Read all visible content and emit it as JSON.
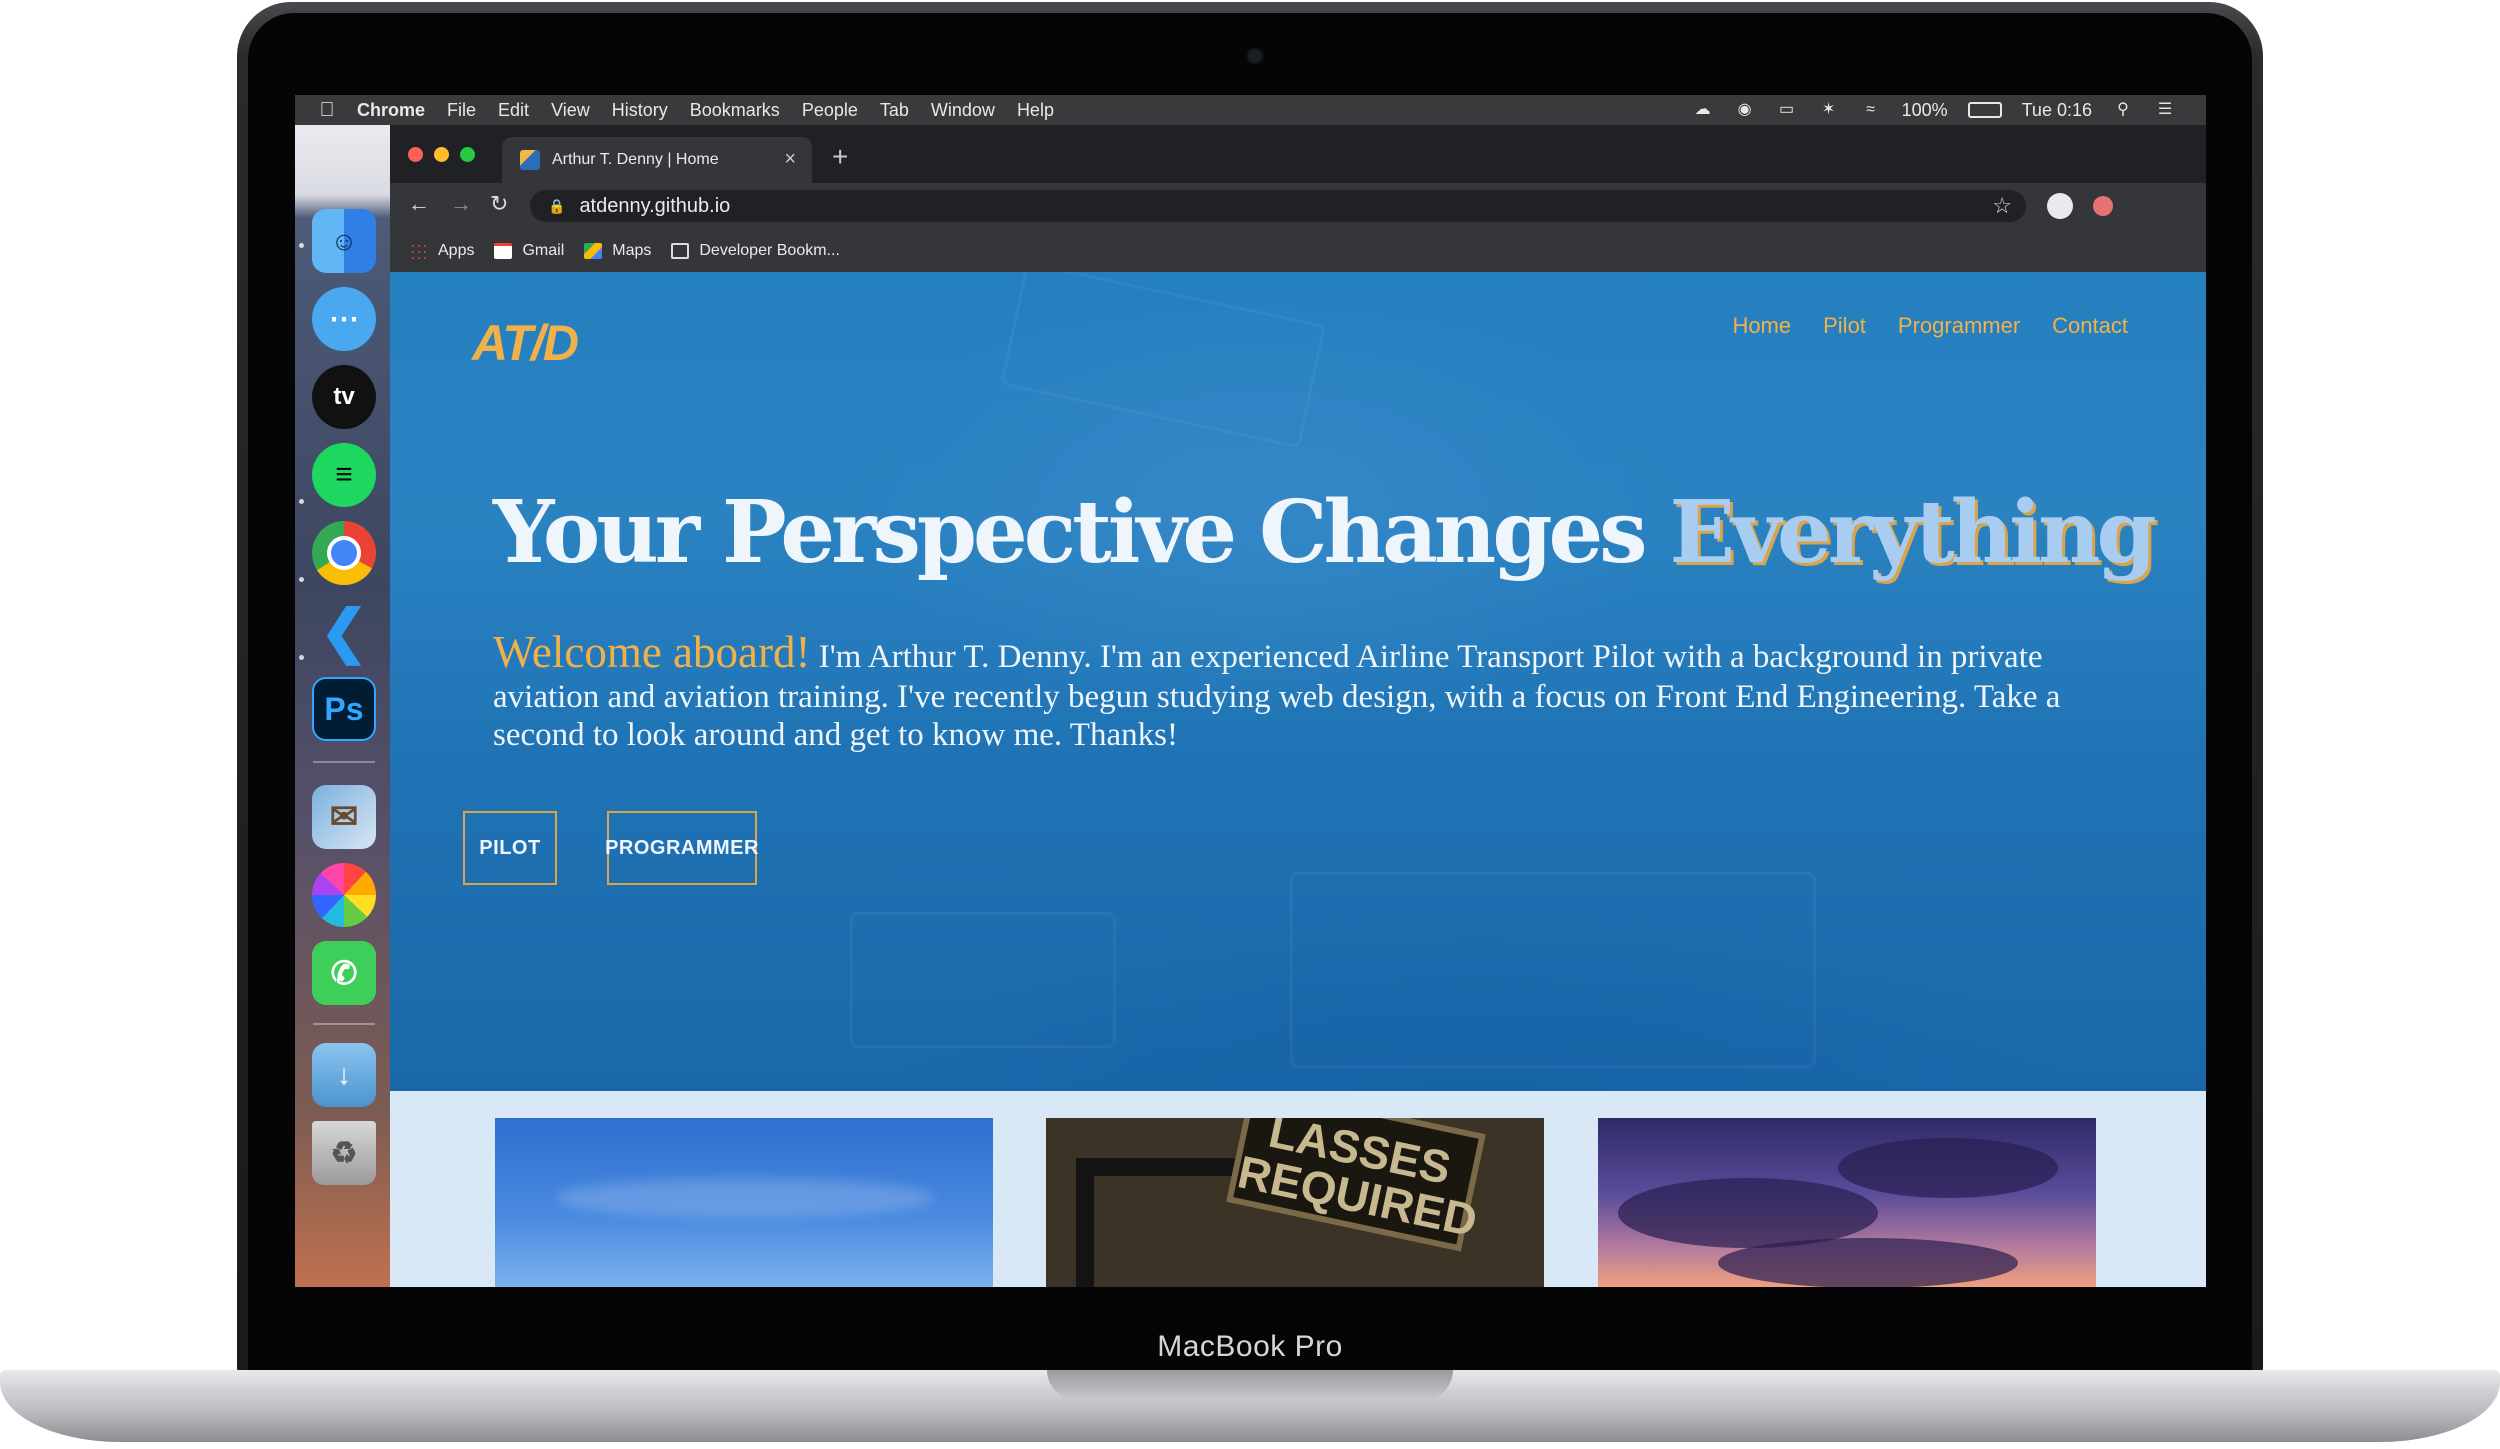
{
  "device": {
    "label": "MacBook Pro"
  },
  "menubar": {
    "app_name": "Chrome",
    "items": [
      "File",
      "Edit",
      "View",
      "History",
      "Bookmarks",
      "People",
      "Tab",
      "Window",
      "Help"
    ],
    "battery": "100%",
    "clock": "Tue 0:16"
  },
  "dock": {
    "apps": [
      "Finder",
      "Messages",
      "TV",
      "Spotify",
      "Chrome",
      "Visual Studio Code",
      "Photoshop",
      "Mail",
      "Photos",
      "FaceTime",
      "Downloads",
      "Trash"
    ],
    "ps_label": "Ps",
    "tv_label": "tv"
  },
  "browser": {
    "tab_title": "Arthur T. Denny | Home",
    "url": "atdenny.github.io",
    "bookmarks": [
      "Apps",
      "Gmail",
      "Maps",
      "Developer Bookm..."
    ]
  },
  "site": {
    "logo": "AT/D",
    "nav": [
      "Home",
      "Pilot",
      "Programmer",
      "Contact"
    ],
    "headline_main": "Your Perspective Changes ",
    "headline_accent": "Everything",
    "welcome": "Welcome aboard!",
    "intro": " I'm Arthur T. Denny. I'm an experienced Airline Transport Pilot with a background in private aviation and aviation training. I've recently begun studying web design, with a focus on Front End Engineering. Take a second to look around and get to know me. Thanks!",
    "buttons": [
      "PILOT",
      "PROGRAMMER"
    ],
    "card2_sign": "LASSES REQUIRED"
  },
  "colors": {
    "accent": "#f0b14a",
    "hero_blue": "#2580c0",
    "chrome_dark": "#202124"
  }
}
